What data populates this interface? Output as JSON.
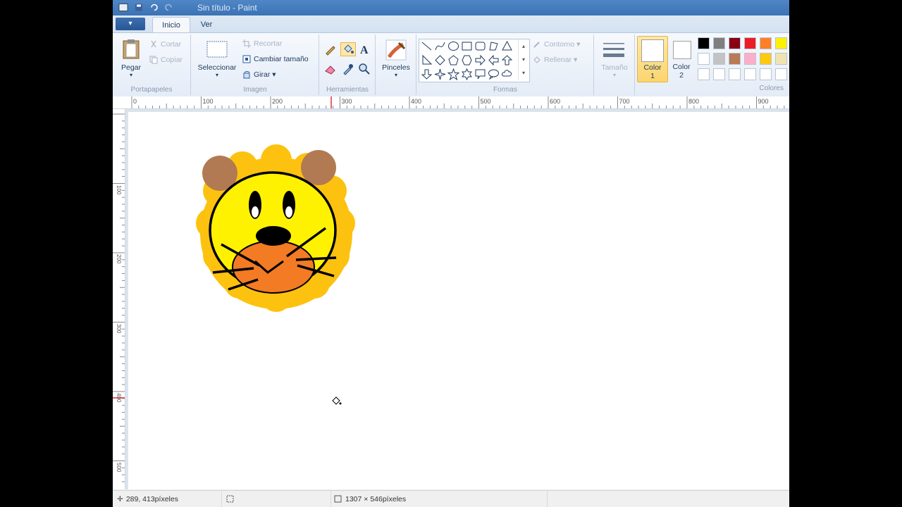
{
  "window": {
    "title": "Sin título - Paint"
  },
  "tabs": {
    "file": "▾",
    "inicio": "Inicio",
    "ver": "Ver"
  },
  "clipboard": {
    "paste": "Pegar",
    "cut": "Cortar",
    "copy": "Copiar",
    "label": "Portapapeles"
  },
  "image": {
    "select": "Seleccionar",
    "crop": "Recortar",
    "resize": "Cambiar tamaño",
    "rotate": "Girar",
    "label": "Imagen"
  },
  "tools": {
    "label": "Herramientas"
  },
  "brushes": {
    "label": "Pinceles"
  },
  "shapes": {
    "outline": "Contorno",
    "fill": "Rellenar",
    "label": "Formas"
  },
  "size": {
    "label": "Tamaño"
  },
  "color1": {
    "label1": "Color",
    "label2": "1"
  },
  "color2": {
    "label1": "Color",
    "label2": "2"
  },
  "colors": {
    "label": "Colores",
    "row1": [
      "#000000",
      "#7f7f7f",
      "#880015",
      "#ed1c24",
      "#ff7f27",
      "#fff200"
    ],
    "row2": [
      "#ffffff",
      "#c3c3c3",
      "#b97a57",
      "#ffaec9",
      "#ffc90e",
      "#efe4b0"
    ],
    "row3": [
      "#ffffff",
      "#ffffff",
      "#ffffff",
      "#ffffff",
      "#ffffff",
      "#ffffff"
    ]
  },
  "ruler": {
    "h": [
      "0",
      "100",
      "200",
      "300",
      "400",
      "500",
      "600",
      "700",
      "800",
      "900"
    ],
    "v": [
      "100",
      "200",
      "300",
      "400",
      "500"
    ]
  },
  "status": {
    "cursor": "289, 413píxeles",
    "size": "1307 × 546píxeles"
  }
}
